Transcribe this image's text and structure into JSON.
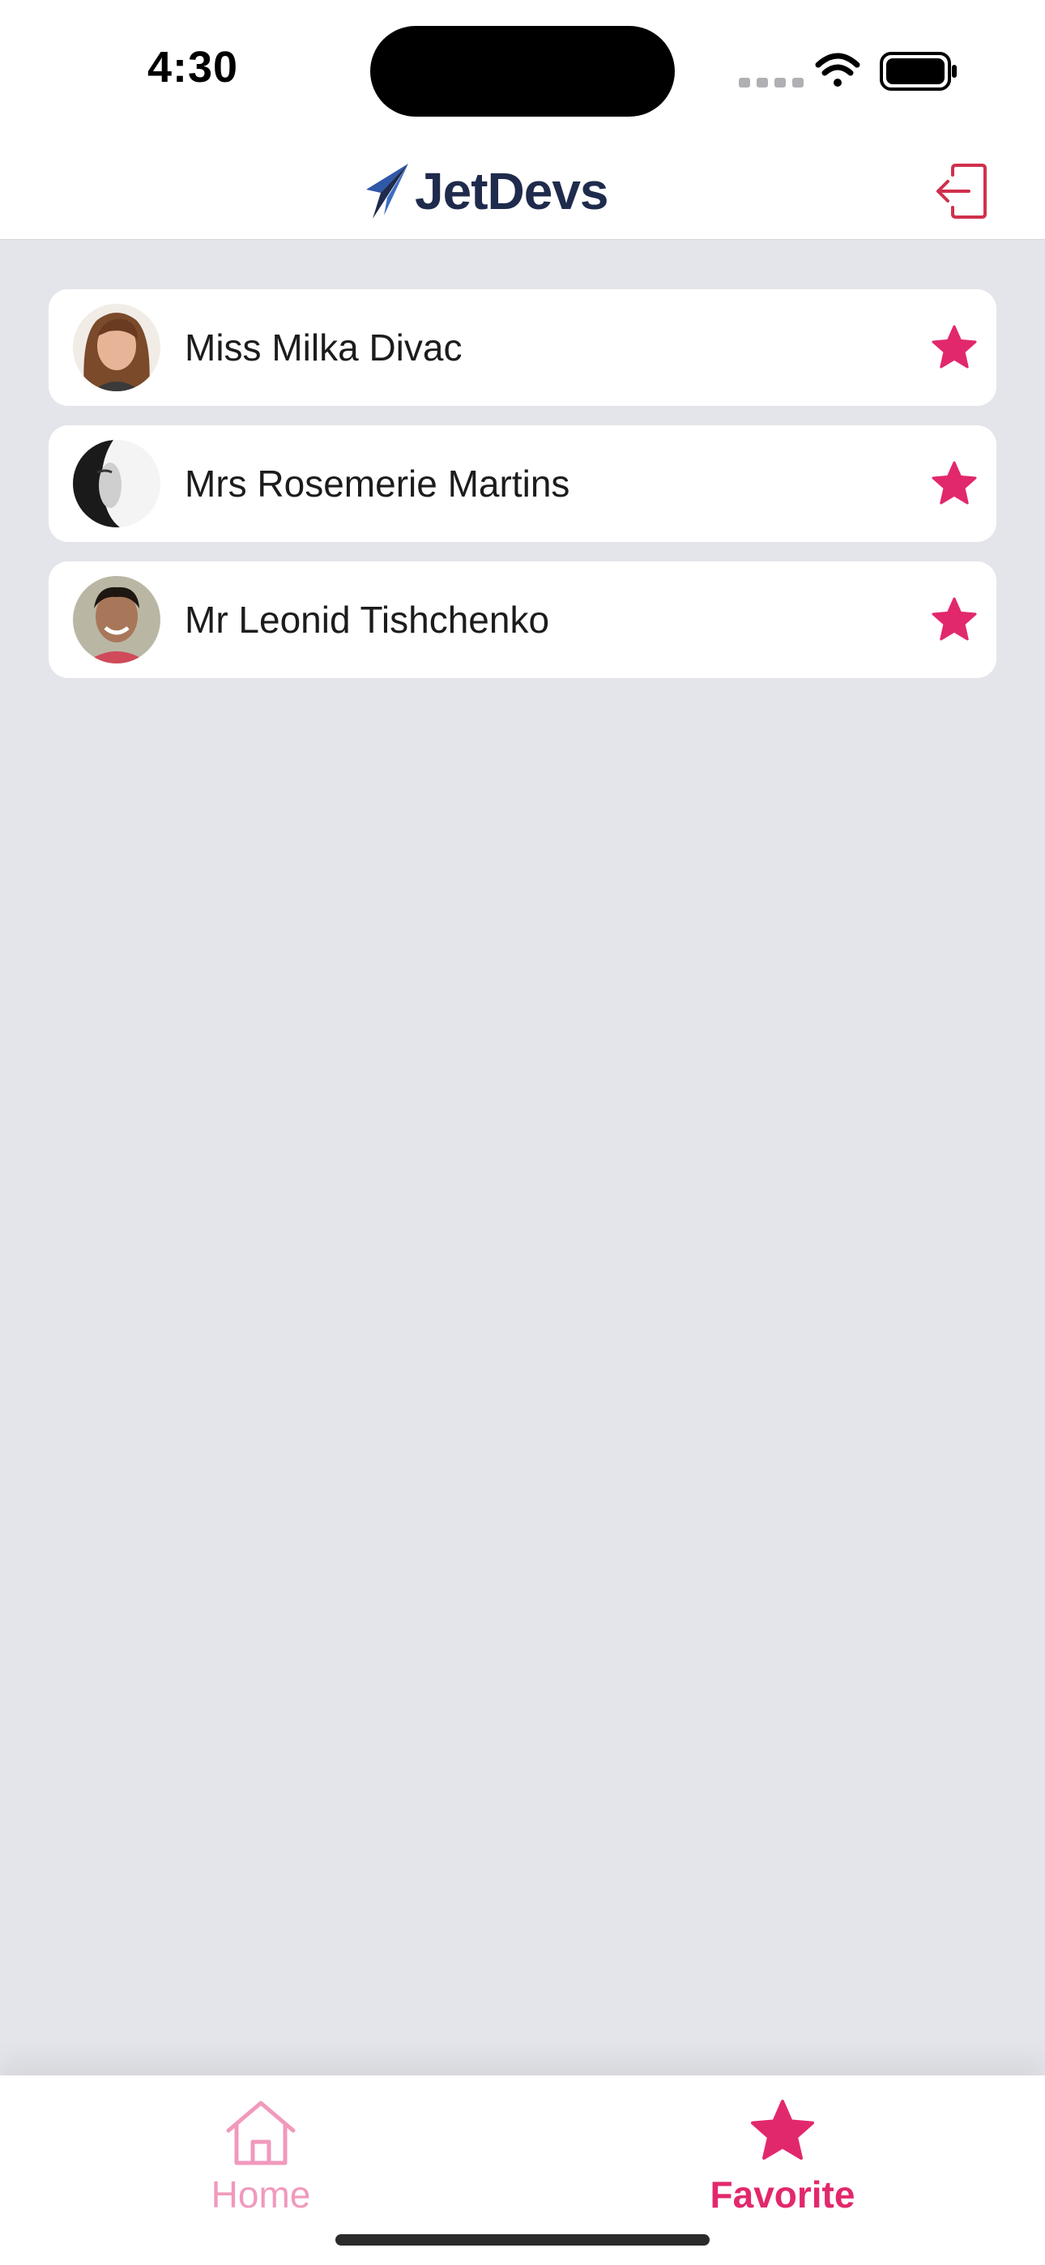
{
  "status_bar": {
    "time": "4:30"
  },
  "header": {
    "logo_text": "JetDevs",
    "logout_icon": "logout-icon"
  },
  "favorites": [
    {
      "name": "Miss Milka Divac",
      "favorite": true
    },
    {
      "name": "Mrs Rosemerie Martins",
      "favorite": true
    },
    {
      "name": "Mr Leonid Tishchenko",
      "favorite": true
    }
  ],
  "tabs": [
    {
      "label": "Home",
      "icon": "home-icon",
      "active": false
    },
    {
      "label": "Favorite",
      "icon": "star-icon",
      "active": true
    }
  ],
  "colors": {
    "accent": "#e2286d",
    "accent_light": "#f199bd",
    "brand_navy": "#1f2b4c",
    "background": "#e4e5ea"
  }
}
